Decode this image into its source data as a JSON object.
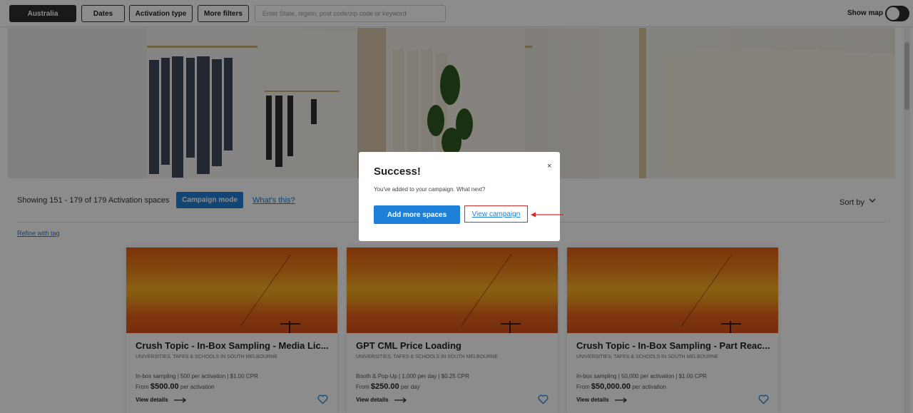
{
  "filters": {
    "location": "Australia",
    "dates": "Dates",
    "activation_type": "Activation type",
    "more_filters": "More filters",
    "search_placeholder": "Enter State, region, post code/zip code or keyword",
    "show_map": "Show map"
  },
  "results": {
    "showing": "Showing 151 - 179 of 179 Activation spaces",
    "campaign_mode": "Campaign mode",
    "whats_this": "What's this?",
    "sort_by": "Sort by",
    "refine": "Refine with tag"
  },
  "cards": [
    {
      "title": "Crush Topic - In-Box Sampling - Media Lic...",
      "subtitle": "UNIVERSITIES, TAFES & SCHOOLS in SOUTH MELBOURNE",
      "meta": "In-box sampling | 500 per activation | $1.00 CPR",
      "from": "From",
      "price": "$500.00",
      "unit": "per activation",
      "details": "View details"
    },
    {
      "title": "GPT CML Price Loading",
      "subtitle": "UNIVERSITIES, TAFES & SCHOOLS in SOUTH MELBOURNE",
      "meta": "Booth & Pop-Up | 1,000 per day | $0.25 CPR",
      "from": "From",
      "price": "$250.00",
      "unit": "per day",
      "details": "View details"
    },
    {
      "title": "Crush Topic - In-Box Sampling - Part Reac...",
      "subtitle": "UNIVERSITIES, TAFES & SCHOOLS in SOUTH MELBOURNE",
      "meta": "In-box sampling | 50,000 per activation | $1.00 CPR",
      "from": "From",
      "price": "$50,000.00",
      "unit": "per activation",
      "details": "View details"
    }
  ],
  "modal": {
    "title": "Success!",
    "message": "You've added to your campaign. What next?",
    "add_more": "Add more spaces",
    "view_campaign": "View campaign",
    "close": "×"
  },
  "icons": {
    "close": "close-icon",
    "heart": "heart-icon",
    "arrow_right": "arrow-right-icon",
    "chevron": "chevron-down-icon"
  },
  "colors": {
    "accent": "#1e7fd8",
    "highlight": "#d62b2b"
  }
}
